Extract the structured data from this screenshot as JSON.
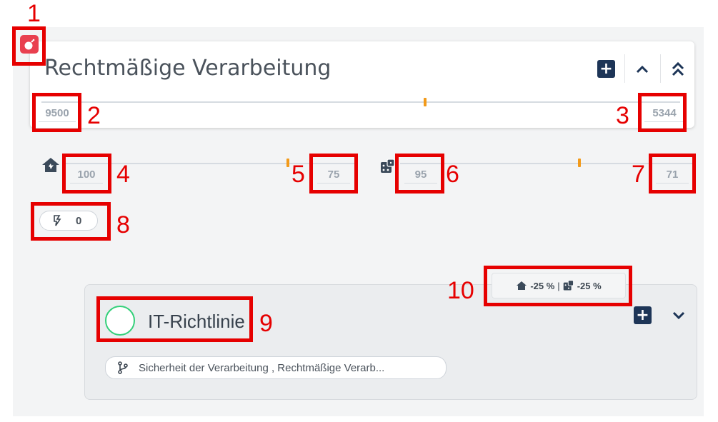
{
  "card": {
    "title": "Rechtmäßige Verarbeitung",
    "left_value": "9500",
    "right_value": "5344"
  },
  "impact": {
    "left_value": "100",
    "right_value": "75"
  },
  "likelihood": {
    "left_value": "95",
    "right_value": "71"
  },
  "threats": {
    "count": "0"
  },
  "measure": {
    "title": "IT-Richtlinie",
    "linked_objectives": "Sicherheit der Verarbeitung , Rechtmäßige Verarb...",
    "modifier_impact": "-25 %",
    "modifier_separator": "|",
    "modifier_likelihood": "-25 %"
  },
  "annotations": {
    "m1": "1",
    "m2": "2",
    "m3": "3",
    "m4": "4",
    "m5": "5",
    "m6": "6",
    "m7": "7",
    "m8": "8",
    "m9": "9",
    "m10": "10"
  },
  "colors": {
    "accent_orange": "#f29a1a",
    "badge_red": "#e9404f",
    "button_navy": "#1d3557",
    "circle_green": "#34d07a",
    "annotation_red": "#e60000"
  },
  "icons": {
    "badge": "bomb-icon",
    "impact": "house-icon",
    "likelihood": "dice-icon",
    "threats": "lightning-icon",
    "linked": "branch-icon"
  }
}
